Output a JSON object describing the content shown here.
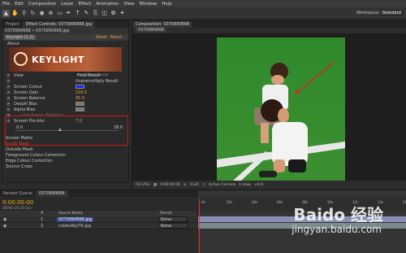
{
  "menu": [
    "File",
    "Edit",
    "Composition",
    "Layer",
    "Effect",
    "Animation",
    "View",
    "Window",
    "Help"
  ],
  "workspace": {
    "label": "Workspace:",
    "value": "Standard"
  },
  "left_panel": {
    "tabs": [
      "Project",
      "Effect Controls: 0370990668.jpg"
    ],
    "crumb": "0370990668 • 0370990668.jpg",
    "effect_name": "Keylight (1.2)",
    "reset": "Reset",
    "about": "About...",
    "about_row": "About",
    "logo_text": "KEYLIGHT",
    "rows": [
      {
        "label": "View",
        "value": "Final Result",
        "kind": "dropdown"
      },
      {
        "label": "",
        "value": "Unpremultiply Result",
        "kind": "check"
      },
      {
        "label": "Screen Colour",
        "value": "",
        "kind": "swatch"
      },
      {
        "label": "Screen Gain",
        "value": "100.0",
        "kind": "num"
      },
      {
        "label": "Screen Balance",
        "value": "95.0",
        "kind": "num"
      },
      {
        "label": "Despill Bias",
        "value": "",
        "kind": "none"
      },
      {
        "label": "Alpha Bias",
        "value": "",
        "kind": "none"
      },
      {
        "label": "",
        "value": "Lock Biases Together",
        "kind": "check"
      },
      {
        "label": "Screen Pre-blur",
        "value": "7.0",
        "kind": "num"
      }
    ],
    "slider": {
      "min": "0.0",
      "max": "28.0",
      "value": 7.0
    },
    "sections": [
      "Screen Matte",
      "Inside Mask",
      "Outside Mask",
      "Foreground Colour Correction",
      "Edge Colour Correction",
      "Source Crops"
    ]
  },
  "comp_panel": {
    "tab": "Composition: 0370990668",
    "sub": "0370990668",
    "zoom": "(62.4%)",
    "time": "0:00:00:00",
    "res": "(Full)",
    "camera": "Active Camera",
    "view": "1 View",
    "exposure": "+0.0"
  },
  "timeline": {
    "tabs": [
      "Render Queue",
      "0370990668"
    ],
    "time": "0:00:00:00",
    "fps": "00000 (25.00 fps)",
    "header": {
      "num": "#",
      "source": "Source Name",
      "mode": "Parent"
    },
    "layers": [
      {
        "index": "1",
        "name": "0370990668.jpg",
        "mode": "None"
      },
      {
        "index": "2",
        "name": "cnkbvAbyTK.jpg",
        "mode": "None"
      }
    ],
    "ruler": [
      "0s",
      "02s",
      "04s",
      "06s",
      "08s",
      "10s",
      "12s",
      "14s",
      "16s"
    ]
  },
  "watermark": {
    "line1": "Baido 经验",
    "line2": "jingyan.baidu.com"
  }
}
